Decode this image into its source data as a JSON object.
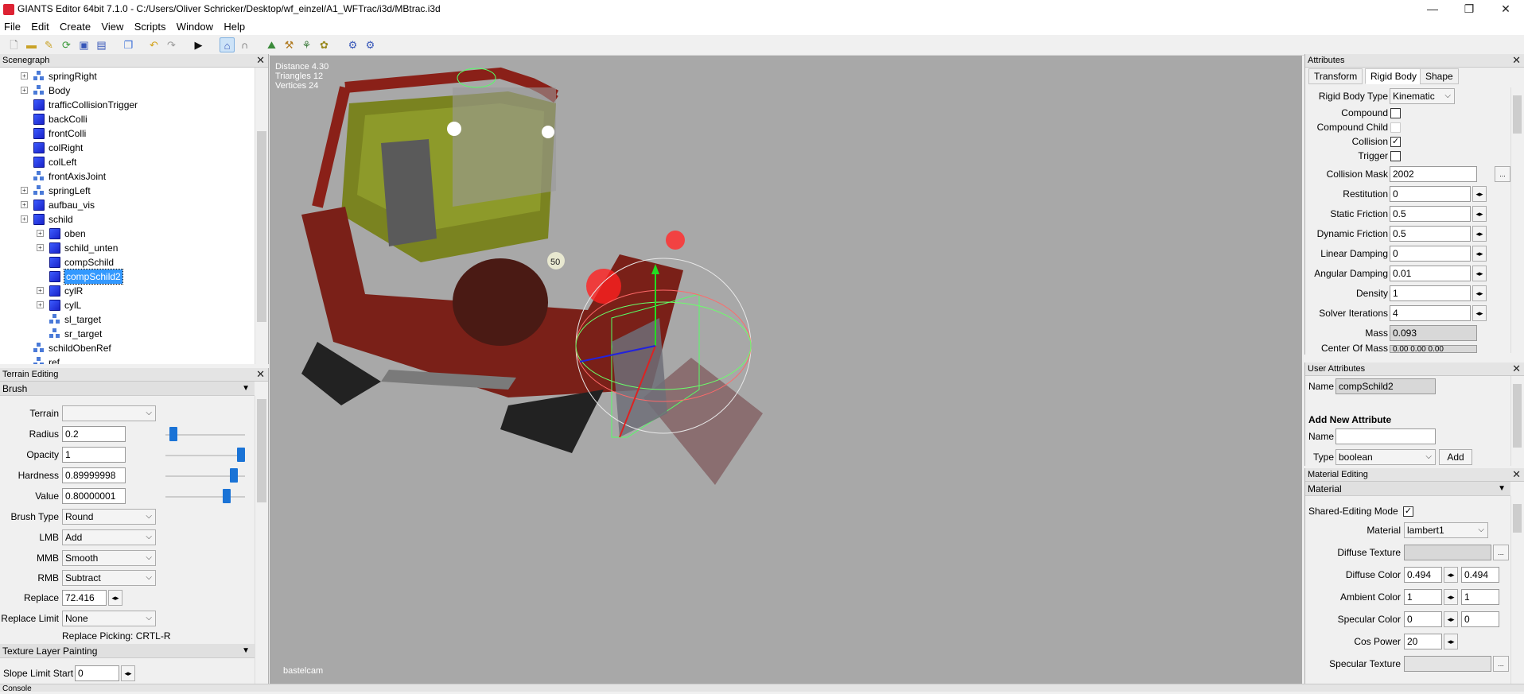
{
  "window": {
    "title": "GIANTS Editor 64bit 7.1.0 - C:/Users/Oliver Schricker/Desktop/wf_einzel/A1_WFTrac/i3d/MBtrac.i3d",
    "minimize": "—",
    "maximize": "❐",
    "close": "✕"
  },
  "menu": [
    "File",
    "Edit",
    "Create",
    "View",
    "Scripts",
    "Window",
    "Help"
  ],
  "scenegraph": {
    "title": "Scenegraph",
    "items": [
      {
        "label": "springRight",
        "icon": "transformgroup-icon",
        "level": 1,
        "expander": true
      },
      {
        "label": "Body",
        "icon": "transformgroup-icon",
        "level": 1,
        "expander": true
      },
      {
        "label": "trafficCollisionTrigger",
        "icon": "shape-cube-icon",
        "level": 1,
        "expander": false
      },
      {
        "label": "backColli",
        "icon": "shape-cube-icon",
        "level": 1,
        "expander": false
      },
      {
        "label": "frontColli",
        "icon": "shape-cube-icon",
        "level": 1,
        "expander": false
      },
      {
        "label": "colRight",
        "icon": "shape-cube-icon",
        "level": 1,
        "expander": false
      },
      {
        "label": "colLeft",
        "icon": "shape-cube-icon",
        "level": 1,
        "expander": false
      },
      {
        "label": "frontAxisJoint",
        "icon": "transformgroup-icon",
        "level": 1,
        "expander": false
      },
      {
        "label": "springLeft",
        "icon": "transformgroup-icon",
        "level": 1,
        "expander": true
      },
      {
        "label": "aufbau_vis",
        "icon": "shape-cube-icon",
        "level": 1,
        "expander": true
      },
      {
        "label": "schild",
        "icon": "shape-cube-icon",
        "level": 1,
        "expander": true
      },
      {
        "label": "oben",
        "icon": "shape-cube-icon",
        "level": 2,
        "expander": true
      },
      {
        "label": "schild_unten",
        "icon": "shape-cube-icon",
        "level": 2,
        "expander": true
      },
      {
        "label": "compSchild",
        "icon": "shape-cube-icon",
        "level": 2,
        "expander": false
      },
      {
        "label": "compSchild2",
        "icon": "shape-cube-icon",
        "level": 2,
        "expander": false,
        "selected": true
      },
      {
        "label": "cylR",
        "icon": "shape-cube-icon",
        "level": 2,
        "expander": true
      },
      {
        "label": "cylL",
        "icon": "shape-cube-icon",
        "level": 2,
        "expander": true
      },
      {
        "label": "sl_target",
        "icon": "transformgroup-icon",
        "level": 2,
        "expander": false
      },
      {
        "label": "sr_target",
        "icon": "transformgroup-icon",
        "level": 2,
        "expander": false
      },
      {
        "label": "schildObenRef",
        "icon": "transformgroup-icon",
        "level": 1,
        "expander": false
      },
      {
        "label": "ref",
        "icon": "transformgroup-icon",
        "level": 1,
        "expander": false
      }
    ]
  },
  "terrain": {
    "title": "Terrain Editing",
    "brush_section": "Brush",
    "terrain_label": "Terrain",
    "terrain_value": "",
    "radius_label": "Radius",
    "radius_value": "0.2",
    "radius_level": 0.05,
    "opacity_label": "Opacity",
    "opacity_value": "1",
    "opacity_level": 1.0,
    "hardness_label": "Hardness",
    "hardness_value": "0.89999998",
    "hardness_level": 0.9,
    "value_label": "Value",
    "value_value": "0.80000001",
    "value_level": 0.8,
    "brushtype_label": "Brush Type",
    "brushtype_value": "Round",
    "lmb_label": "LMB",
    "lmb_value": "Add",
    "mmb_label": "MMB",
    "mmb_value": "Smooth",
    "rmb_label": "RMB",
    "rmb_value": "Subtract",
    "replace_label": "Replace",
    "replace_value": "72.416",
    "replacelimit_label": "Replace Limit",
    "replacelimit_value": "None",
    "replace_picking": "Replace Picking: CRTL-R",
    "texture_section": "Texture Layer Painting",
    "slope_label": "Slope Limit Start",
    "slope_value": "0"
  },
  "viewport": {
    "distance": "Distance 4.30",
    "triangles": "Triangles 12",
    "vertices": "Vertices 24",
    "camera": "bastelcam",
    "plate_number": "50"
  },
  "attributes": {
    "title": "Attributes",
    "tabs": [
      "Transform",
      "Rigid Body",
      "Shape"
    ],
    "active_tab": "Rigid Body",
    "rbtype_label": "Rigid Body Type",
    "rbtype_value": "Kinematic",
    "compound_label": "Compound",
    "compound_checked": false,
    "compoundchild_label": "Compound Child",
    "compoundchild_checked": false,
    "collision_label": "Collision",
    "collision_checked": true,
    "trigger_label": "Trigger",
    "trigger_checked": false,
    "collisionmask_label": "Collision Mask",
    "collisionmask_value": "2002",
    "collisionmask_btn": "...",
    "restitution_label": "Restitution",
    "restitution_value": "0",
    "staticfriction_label": "Static Friction",
    "staticfriction_value": "0.5",
    "dynamicfriction_label": "Dynamic Friction",
    "dynamicfriction_value": "0.5",
    "lineardamping_label": "Linear Damping",
    "lineardamping_value": "0",
    "angulardamping_label": "Angular Damping",
    "angulardamping_value": "0.01",
    "density_label": "Density",
    "density_value": "1",
    "solver_label": "Solver Iterations",
    "solver_value": "4",
    "mass_label": "Mass",
    "mass_value": "0.093",
    "centerofmass_label": "Center Of Mass",
    "centerofmass_value": "0.00 0.00 0.00"
  },
  "user_attributes": {
    "title": "User Attributes",
    "name_label": "Name",
    "name_value": "compSchild2",
    "add_title": "Add New Attribute",
    "new_name_label": "Name",
    "new_name_value": "",
    "type_label": "Type",
    "type_value": "boolean",
    "add_button": "Add"
  },
  "material": {
    "title": "Material Editing",
    "section": "Material",
    "shared_label": "Shared-Editing Mode",
    "shared_checked": true,
    "material_label": "Material",
    "material_value": "lambert1",
    "diffuse_tex_label": "Diffuse Texture",
    "diffuse_tex_value": "",
    "diffuse_color_label": "Diffuse Color",
    "diffuse_color_r": "0.494",
    "diffuse_color_g": "0.494",
    "ambient_label": "Ambient Color",
    "ambient_r": "1",
    "ambient_g": "1",
    "specular_label": "Specular Color",
    "specular_r": "0",
    "specular_g": "0",
    "cospower_label": "Cos Power",
    "cospower_value": "20",
    "specular_tex_label": "Specular Texture",
    "specular_tex_value": "",
    "browse": "..."
  },
  "console": {
    "title": "Console"
  },
  "colors": {
    "selection": "#3399ff",
    "viewport_bg": "#a8a8a8",
    "accent": "#1a73d6"
  }
}
